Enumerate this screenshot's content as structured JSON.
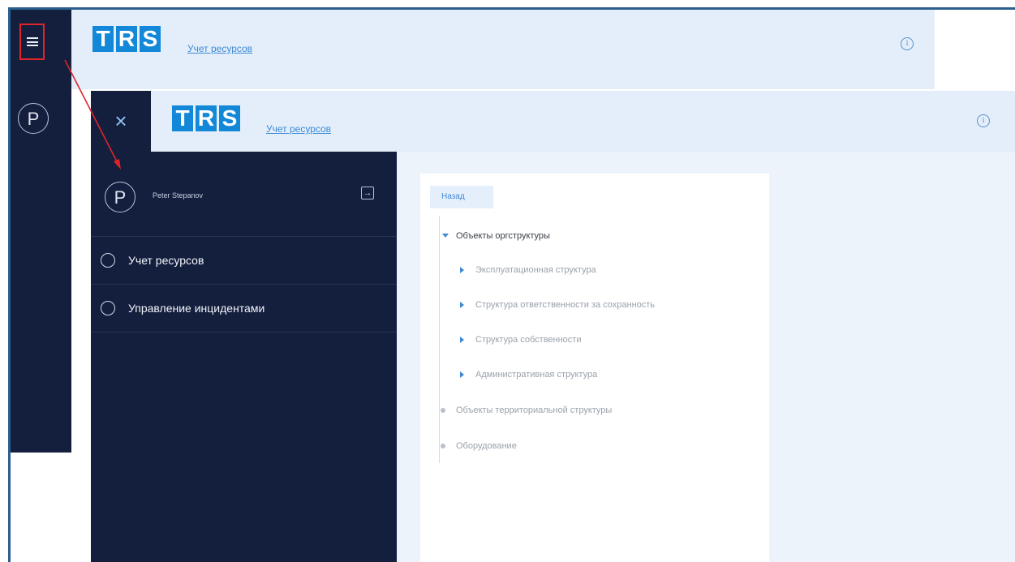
{
  "brand": {
    "logo_letters": [
      "T",
      "R",
      "S"
    ],
    "logo_color": "#1488d8",
    "nav_bg": "#141e3d",
    "header_bg": "#e4eefa"
  },
  "background_app": {
    "app_link": "Учет ресурсов",
    "avatar_letter": "P"
  },
  "overlay": {
    "close_symbol": "×",
    "app_link": "Учет ресурсов",
    "user": {
      "avatar_letter": "P",
      "name": "Peter Stepanov"
    },
    "menu": [
      {
        "label": "Учет ресурсов"
      },
      {
        "label": "Управление инцидентами"
      }
    ]
  },
  "tree": {
    "back_label": "Назад",
    "nodes": [
      {
        "label": "Объекты оргструктуры",
        "level": 0,
        "expanded": true
      },
      {
        "label": "Эксплуатационная структура",
        "level": 1
      },
      {
        "label": "Структура ответственности за сохранность",
        "level": 1
      },
      {
        "label": "Структура собственности",
        "level": 1
      },
      {
        "label": "Административная структура",
        "level": 1
      },
      {
        "label": "Объекты территориальной структуры",
        "level": 0
      },
      {
        "label": "Оборудование",
        "level": 0
      }
    ]
  },
  "annotation": {
    "color": "#e0242b"
  }
}
